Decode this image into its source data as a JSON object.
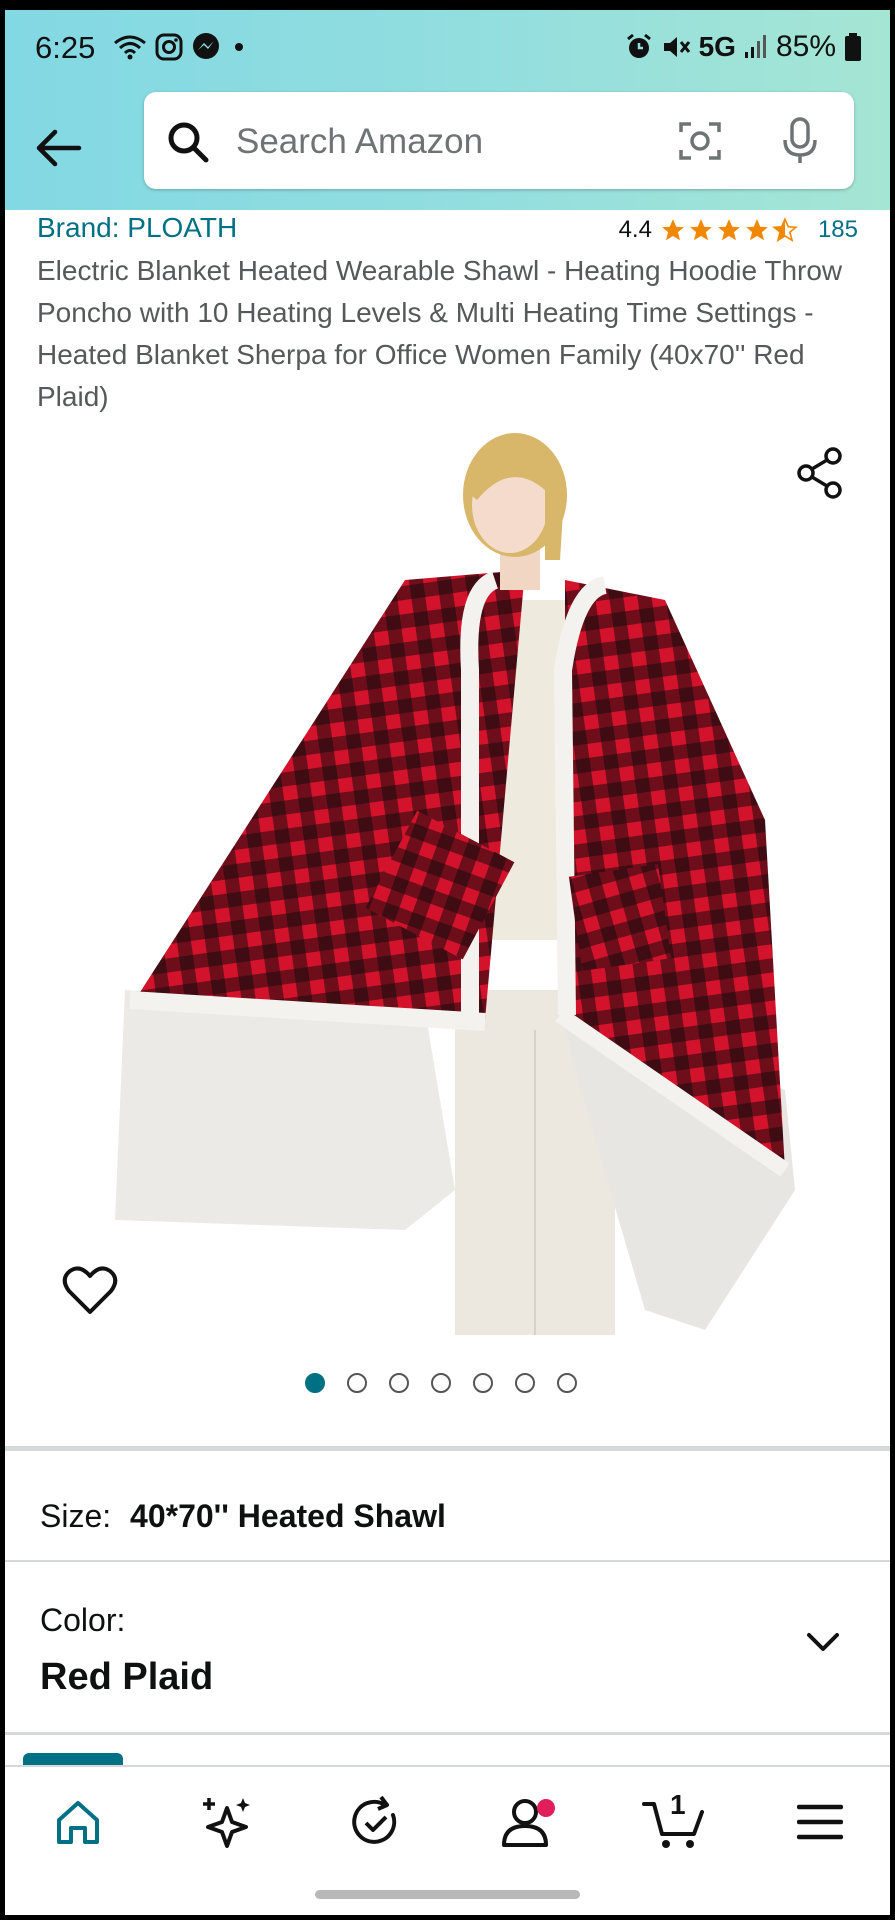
{
  "status_bar": {
    "time": "6:25",
    "network": "5G",
    "battery": "85%"
  },
  "search": {
    "placeholder": "Search Amazon"
  },
  "product": {
    "brand": "Brand: PLOATH",
    "rating": "4.4",
    "rating_stars": 4.4,
    "review_count": "185",
    "title": "Electric Blanket Heated Wearable Shawl - Heating Hoodie Throw Poncho with 10 Heating Levels & Multi Heating Time Settings - Heated Blanket Sherpa for Office Women Family (40x70'' Red Plaid)",
    "image_count": 7,
    "active_image": 1
  },
  "options": {
    "size_label": "Size:",
    "size_value": "40*70'' Heated Shawl",
    "color_label": "Color:",
    "color_value": "Red Plaid"
  },
  "nav": {
    "cart_count": "1",
    "items": [
      "home-icon",
      "sparkle-icon",
      "returns-icon",
      "account-icon",
      "cart-icon",
      "menu-icon"
    ]
  },
  "colors": {
    "accent": "#007185",
    "star": "#f08804",
    "plaid_red": "#d3122b",
    "badge": "#e01e5a"
  }
}
